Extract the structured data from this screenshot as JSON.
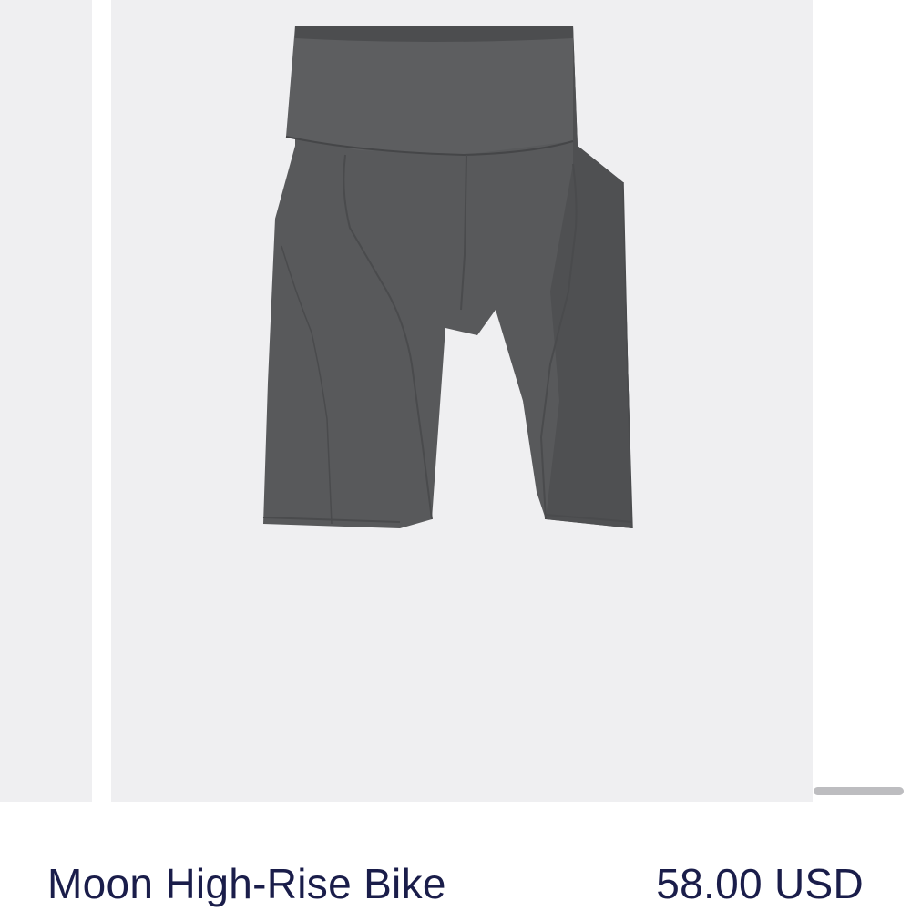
{
  "product": {
    "name": "Moon High-Rise Bike",
    "price": "58.00 USD",
    "image_icon": "bike-shorts-image"
  },
  "colors": {
    "slide_background": "#efeff1",
    "garment": "#58595b",
    "text": "#1a1d4a",
    "indicator": "#bdbdc0"
  }
}
